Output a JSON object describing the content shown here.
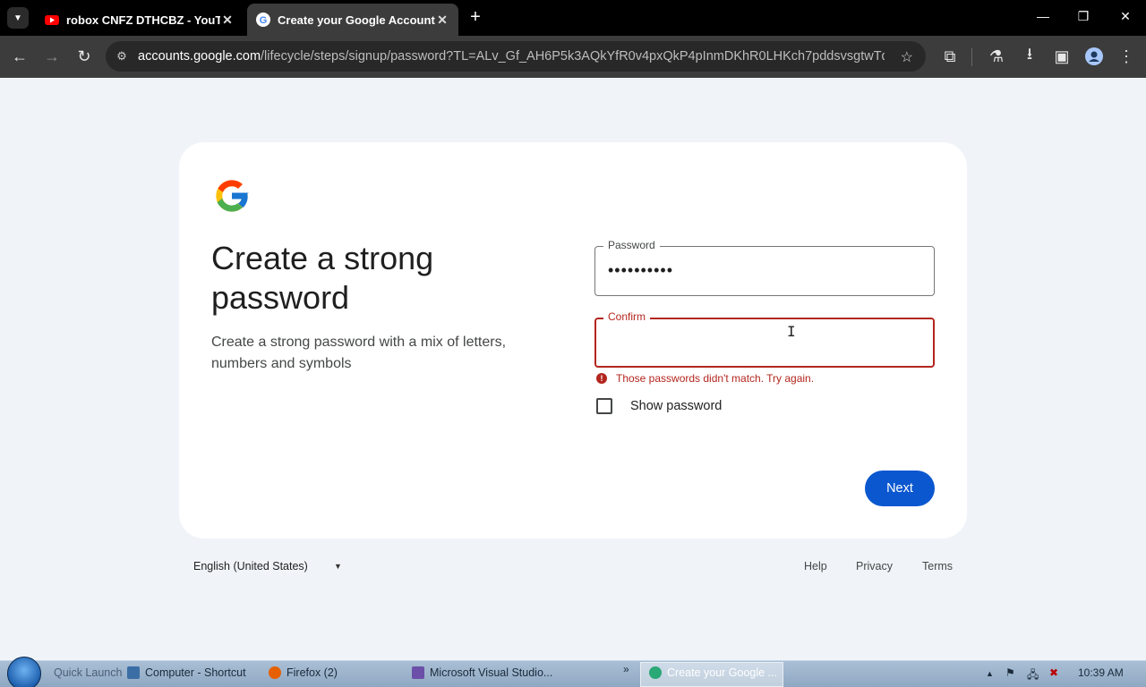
{
  "browser": {
    "tabs": [
      {
        "title": "robox CNFZ DTHCBZ - YouTube",
        "favicon": "youtube-icon",
        "active": false
      },
      {
        "title": "Create your Google Account",
        "favicon": "google-icon",
        "active": true
      }
    ],
    "url_host": "accounts.google.com",
    "url_path": "/lifecycle/steps/signup/password?TL=ALv_Gf_AH6P5k3AQkYfR0v4pxQkP4pInmDKhR0LHKch7pddsvsgtwTdV2ZcY..."
  },
  "page": {
    "heading": "Create a strong password",
    "subtext": "Create a strong password with a mix of letters, numbers and symbols",
    "password_label": "Password",
    "password_value": "••••••••••",
    "confirm_label": "Confirm",
    "confirm_value": "",
    "error_text": "Those passwords didn't match. Try again.",
    "show_password_label": "Show password",
    "show_password_checked": false,
    "next_label": "Next"
  },
  "footer": {
    "language": "English (United States)",
    "links": [
      "Help",
      "Privacy",
      "Terms"
    ]
  },
  "taskbar": {
    "quick_launch": "Quick Launch",
    "items": [
      "Computer - Shortcut",
      "Firefox (2)",
      "Microsoft Visual Studio...",
      "Create your Google ..."
    ],
    "overflow": "»",
    "clock": "10:39 AM"
  },
  "colors": {
    "accent": "#0b57d0",
    "error": "#b3261e",
    "page_bg": "#f0f4f9"
  }
}
